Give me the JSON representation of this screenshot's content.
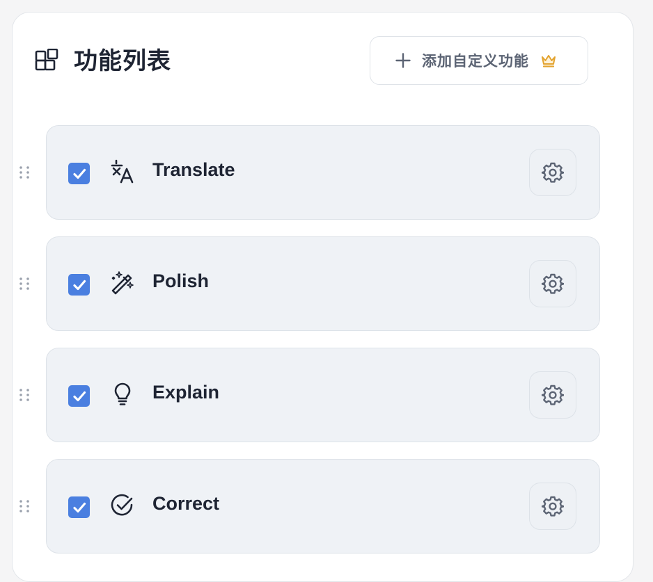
{
  "header": {
    "icon": "blocks-icon",
    "title": "功能列表",
    "add_button": {
      "icon": "plus-icon",
      "label": "添加自定义功能",
      "badge_icon": "crown-icon",
      "badge_color": "#e3a32f"
    }
  },
  "colors": {
    "checkbox_accent": "#4a7fe0",
    "item_background": "#eff2f6",
    "text_primary": "#1e2433"
  },
  "features": [
    {
      "label": "Translate",
      "icon": "translate-icon",
      "checked": true,
      "settings_icon": "gear-icon"
    },
    {
      "label": "Polish",
      "icon": "magic-wand-icon",
      "checked": true,
      "settings_icon": "gear-icon"
    },
    {
      "label": "Explain",
      "icon": "lightbulb-icon",
      "checked": true,
      "settings_icon": "gear-icon"
    },
    {
      "label": "Correct",
      "icon": "check-circle-icon",
      "checked": true,
      "settings_icon": "gear-icon"
    }
  ]
}
